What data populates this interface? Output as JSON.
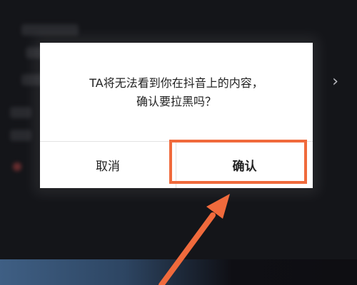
{
  "dialog": {
    "message_line1": "TA将无法看到你在抖音上的内容，",
    "message_line2": "确认要拉黑吗？",
    "cancel_label": "取消",
    "confirm_label": "确认"
  },
  "icons": {
    "chevron": "chevron-right-icon",
    "arrow": "annotation-arrow-icon"
  },
  "colors": {
    "highlight": "#f06a3c",
    "dialog_bg": "#ffffff",
    "overlay_bg": "#141519"
  }
}
